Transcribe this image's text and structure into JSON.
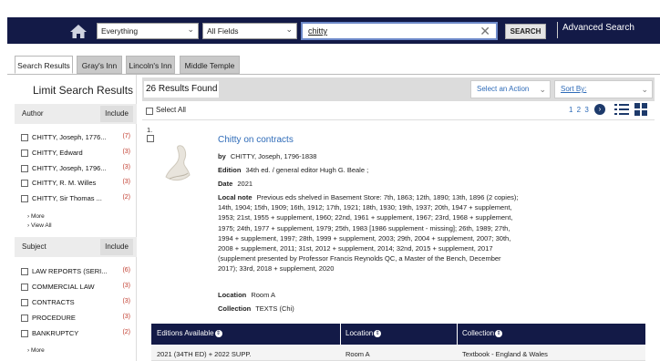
{
  "topbar": {
    "scope_select": "Everything",
    "field_select": "All Fields",
    "query": "chitty",
    "search_button": "SEARCH",
    "advanced_link": "Advanced Search"
  },
  "tabs": [
    "Search Results",
    "Gray's Inn",
    "Lincoln's Inn",
    "Middle Temple"
  ],
  "sidebar": {
    "title": "Limit Search Results",
    "author": {
      "label": "Author",
      "include": "Include",
      "items": [
        {
          "name": "CHITTY, Joseph, 1776...",
          "count": "(7)"
        },
        {
          "name": "CHITTY, Edward",
          "count": "(3)"
        },
        {
          "name": "CHITTY, Joseph, 1796...",
          "count": "(3)"
        },
        {
          "name": "CHITTY, R. M. Willes",
          "count": "(3)"
        },
        {
          "name": "CHITTY, Sir Thomas ...",
          "count": "(2)"
        }
      ],
      "more": "More",
      "view_all": "View All"
    },
    "subject": {
      "label": "Subject",
      "include": "Include",
      "items": [
        {
          "name": "LAW REPORTS (SERI...",
          "count": "(6)"
        },
        {
          "name": "COMMERCIAL LAW",
          "count": "(3)"
        },
        {
          "name": "CONTRACTS",
          "count": "(3)"
        },
        {
          "name": "PROCEDURE",
          "count": "(3)"
        },
        {
          "name": "BANKRUPTCY",
          "count": "(2)"
        }
      ],
      "more": "More"
    }
  },
  "results": {
    "count_text": "26 Results Found",
    "action_select": "Select an Action",
    "sort_select": "Sort By:",
    "select_all": "Select All",
    "pages": "1 2 3"
  },
  "record": {
    "number": "1.",
    "title": "Chitty on contracts",
    "by_label": "by",
    "by": "CHITTY, Joseph, 1796-1838",
    "edition_label": "Edition",
    "edition": "34th ed. / general editor Hugh G. Beale ;",
    "date_label": "Date",
    "date": "2021",
    "local_note_label": "Local note",
    "local_note": "Previous eds shelved in Basement Store: 7th, 1863; 12th, 1890; 13th, 1896 (2 copies); 14th, 1904; 15th, 1909; 16th, 1912; 17th, 1921; 18th, 1930; 19th, 1937; 20th, 1947 + supplement, 1953; 21st, 1955 + supplement, 1960; 22nd, 1961 + supplement, 1967; 23rd, 1968 + supplement, 1975; 24th, 1977 + supplement, 1979; 25th, 1983 [1986 supplement - missing]; 26th, 1989; 27th, 1994 + supplement, 1997; 28th, 1999 + supplement, 2003; 29th, 2004 + supplement, 2007; 30th, 2008 + supplement, 2011; 31st, 2012 + supplement, 2014; 32nd, 2015 + supplement, 2017 (supplement presented by Professor Francis Reynolds QC, a Master of the Bench, December 2017); 33rd, 2018 + supplement, 2020",
    "location_label": "Location",
    "location": "Room A",
    "collection_label": "Collection",
    "collection": "TEXTS (Chi)"
  },
  "editions": {
    "headers": [
      "Editions Available",
      "Location",
      "Collection"
    ],
    "rows": [
      [
        "2021 (34TH ED) + 2022 SUPP.",
        "Room A",
        "Textbook - England & Wales"
      ]
    ]
  },
  "colors": {
    "navy": "#131a47",
    "link": "#2e6bb8",
    "count_red": "#c0392b"
  }
}
